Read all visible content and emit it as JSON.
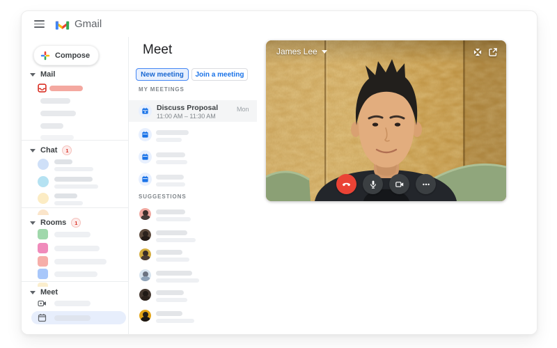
{
  "app": {
    "name": "Gmail"
  },
  "sidebar": {
    "compose": {
      "label": "Compose",
      "icon": "multicolor-plus-icon"
    },
    "sections": {
      "mail": {
        "label": "Mail"
      },
      "chat": {
        "label": "Chat",
        "badge": "1"
      },
      "rooms": {
        "label": "Rooms",
        "badge": "1"
      },
      "meet": {
        "label": "Meet"
      }
    }
  },
  "meet_panel": {
    "title": "Meet",
    "buttons": {
      "new_meeting": "New meeting",
      "join_meeting": "Join a meeting"
    },
    "my_meetings_heading": "MY MEETINGS",
    "suggestions_heading": "SUGGESTIONS",
    "meetings": [
      {
        "title": "Discuss Proposal",
        "time": "11:00 AM – 11:30 AM",
        "day": "Mon"
      }
    ]
  },
  "video_call": {
    "participant": {
      "name": "James Lee"
    },
    "window_icons": [
      "collapse-icon",
      "open-in-new-icon"
    ],
    "controls": [
      "hang-up",
      "microphone",
      "camera",
      "more-options"
    ]
  },
  "colors": {
    "accent_blue": "#1a73e8",
    "button_blue_bg": "#e8f0fe",
    "hangup_red": "#ea4335",
    "control_dark": "#3b3f42",
    "badge_red": "#d93025",
    "skeleton_gray": "#e7e9ec",
    "skeleton_salmon": "#f4a8a0",
    "active_row_bg": "#e7eefc"
  }
}
